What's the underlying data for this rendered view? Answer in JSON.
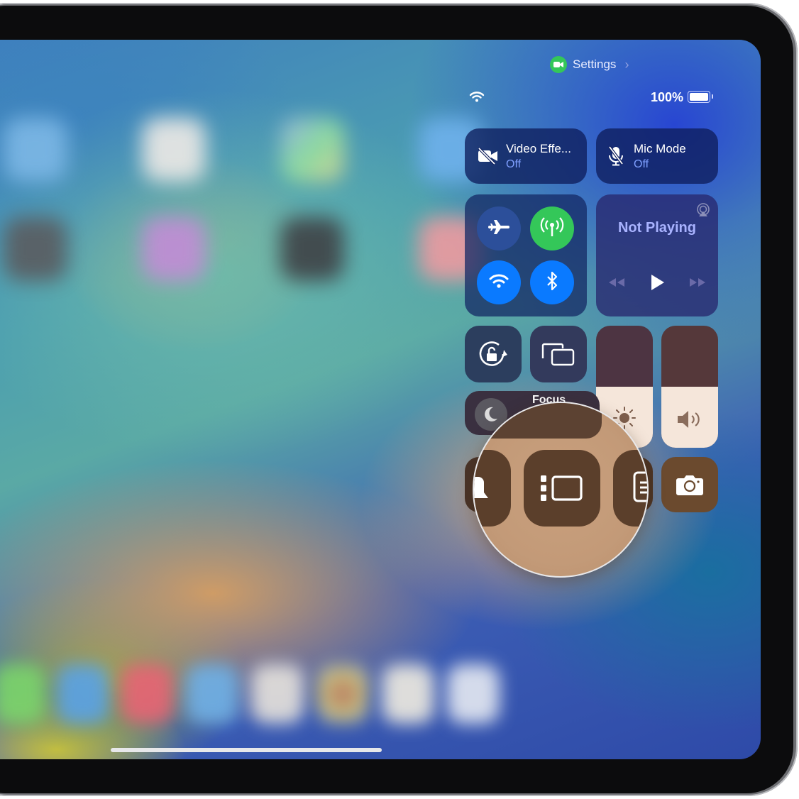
{
  "header": {
    "app_indicator_icon": "video-camera-icon",
    "app_indicator_color": "#34c759",
    "settings_label": "Settings",
    "settings_chevron": "›"
  },
  "status_bar": {
    "wifi_icon": "wifi-icon",
    "battery_percent": "100%",
    "battery_level": 1.0
  },
  "control_center": {
    "video_effects": {
      "title": "Video Effe...",
      "state": "Off",
      "icon": "video-slash-icon"
    },
    "mic_mode": {
      "title": "Mic Mode",
      "state": "Off",
      "icon": "mic-slash-icon"
    },
    "connectivity": {
      "airplane": {
        "icon": "airplane-icon",
        "on": false
      },
      "cellular": {
        "icon": "antenna-icon",
        "on": true,
        "color": "#34c759"
      },
      "wifi": {
        "icon": "wifi-icon",
        "on": true,
        "color": "#0a7aff"
      },
      "bluetooth": {
        "icon": "bluetooth-icon",
        "on": true,
        "color": "#0a7aff"
      }
    },
    "now_playing": {
      "title": "Not Playing",
      "airplay_icon": "airplay-audio-icon",
      "controls": [
        "rewind-icon",
        "play-icon",
        "fast-forward-icon"
      ]
    },
    "orientation_lock": {
      "icon": "rotation-lock-icon"
    },
    "screen_mirroring": {
      "icon": "screen-mirroring-icon"
    },
    "focus": {
      "label": "Focus",
      "icon": "moon-icon"
    },
    "brightness": {
      "icon": "sun-icon",
      "level": 0.5
    },
    "volume": {
      "icon": "speaker-icon",
      "level": 0.5
    },
    "bottom_row": [
      {
        "icon": "bell-icon",
        "name": "silent-mode"
      },
      {
        "icon": "stage-manager-icon",
        "name": "stage-manager",
        "highlighted": true
      },
      {
        "icon": "notes-icon",
        "name": "quick-note"
      },
      {
        "icon": "camera-icon",
        "name": "camera"
      }
    ]
  },
  "magnifier": {
    "focus_item": "Stage Manager"
  }
}
